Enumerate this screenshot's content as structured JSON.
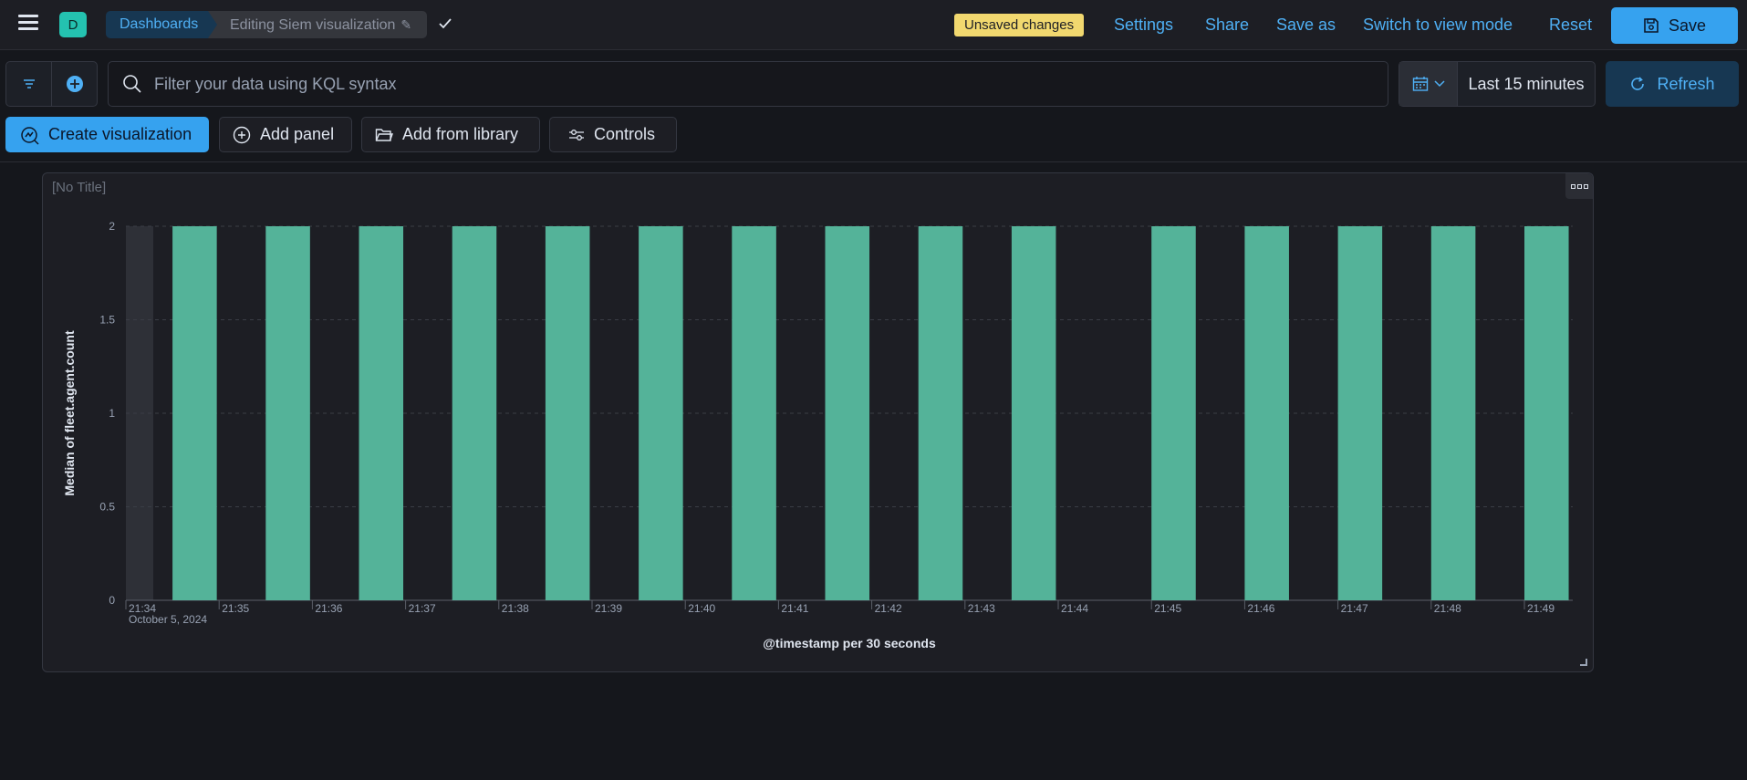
{
  "header": {
    "space_initial": "D",
    "breadcrumb_root": "Dashboards",
    "breadcrumb_current": "Editing Siem visualization",
    "unsaved_badge": "Unsaved changes",
    "links": [
      "Settings",
      "Share",
      "Save as",
      "Switch to view mode",
      "Reset"
    ],
    "save_label": "Save"
  },
  "query": {
    "placeholder": "Filter your data using KQL syntax",
    "time_range": "Last 15 minutes",
    "refresh_label": "Refresh"
  },
  "toolbar": {
    "create_visualization": "Create visualization",
    "add_panel": "Add panel",
    "add_from_library": "Add from library",
    "controls": "Controls"
  },
  "panel": {
    "title": "[No Title]"
  },
  "colors": {
    "bar": "#54b399",
    "accent": "#36a2ef",
    "warning_badge": "#f1d86f"
  },
  "chart_data": {
    "type": "bar",
    "ylabel": "Median of fleet.agent.count",
    "xlabel": "@timestamp per 30 seconds",
    "date_label": "October 5, 2024",
    "ylim": [
      0,
      2
    ],
    "y_ticks": [
      "0",
      "0.5",
      "1",
      "1.5",
      "2"
    ],
    "x_ticks": [
      "21:34",
      "21:35",
      "21:36",
      "21:37",
      "21:38",
      "21:39",
      "21:40",
      "21:41",
      "21:42",
      "21:43",
      "21:44",
      "21:45",
      "21:46",
      "21:47",
      "21:48",
      "21:49"
    ],
    "bars": [
      {
        "x": "21:34:30",
        "y": 2
      },
      {
        "x": "21:35:30",
        "y": 2
      },
      {
        "x": "21:36:30",
        "y": 2
      },
      {
        "x": "21:37:30",
        "y": 2
      },
      {
        "x": "21:38:30",
        "y": 2
      },
      {
        "x": "21:39:30",
        "y": 2
      },
      {
        "x": "21:40:30",
        "y": 2
      },
      {
        "x": "21:41:30",
        "y": 2
      },
      {
        "x": "21:42:30",
        "y": 2
      },
      {
        "x": "21:43:30",
        "y": 2
      },
      {
        "x": "21:45:00",
        "y": 2
      },
      {
        "x": "21:46:00",
        "y": 2
      },
      {
        "x": "21:47:00",
        "y": 2
      },
      {
        "x": "21:48:00",
        "y": 2
      },
      {
        "x": "21:49:00",
        "y": 2
      }
    ],
    "grid": true,
    "legend": "none"
  }
}
